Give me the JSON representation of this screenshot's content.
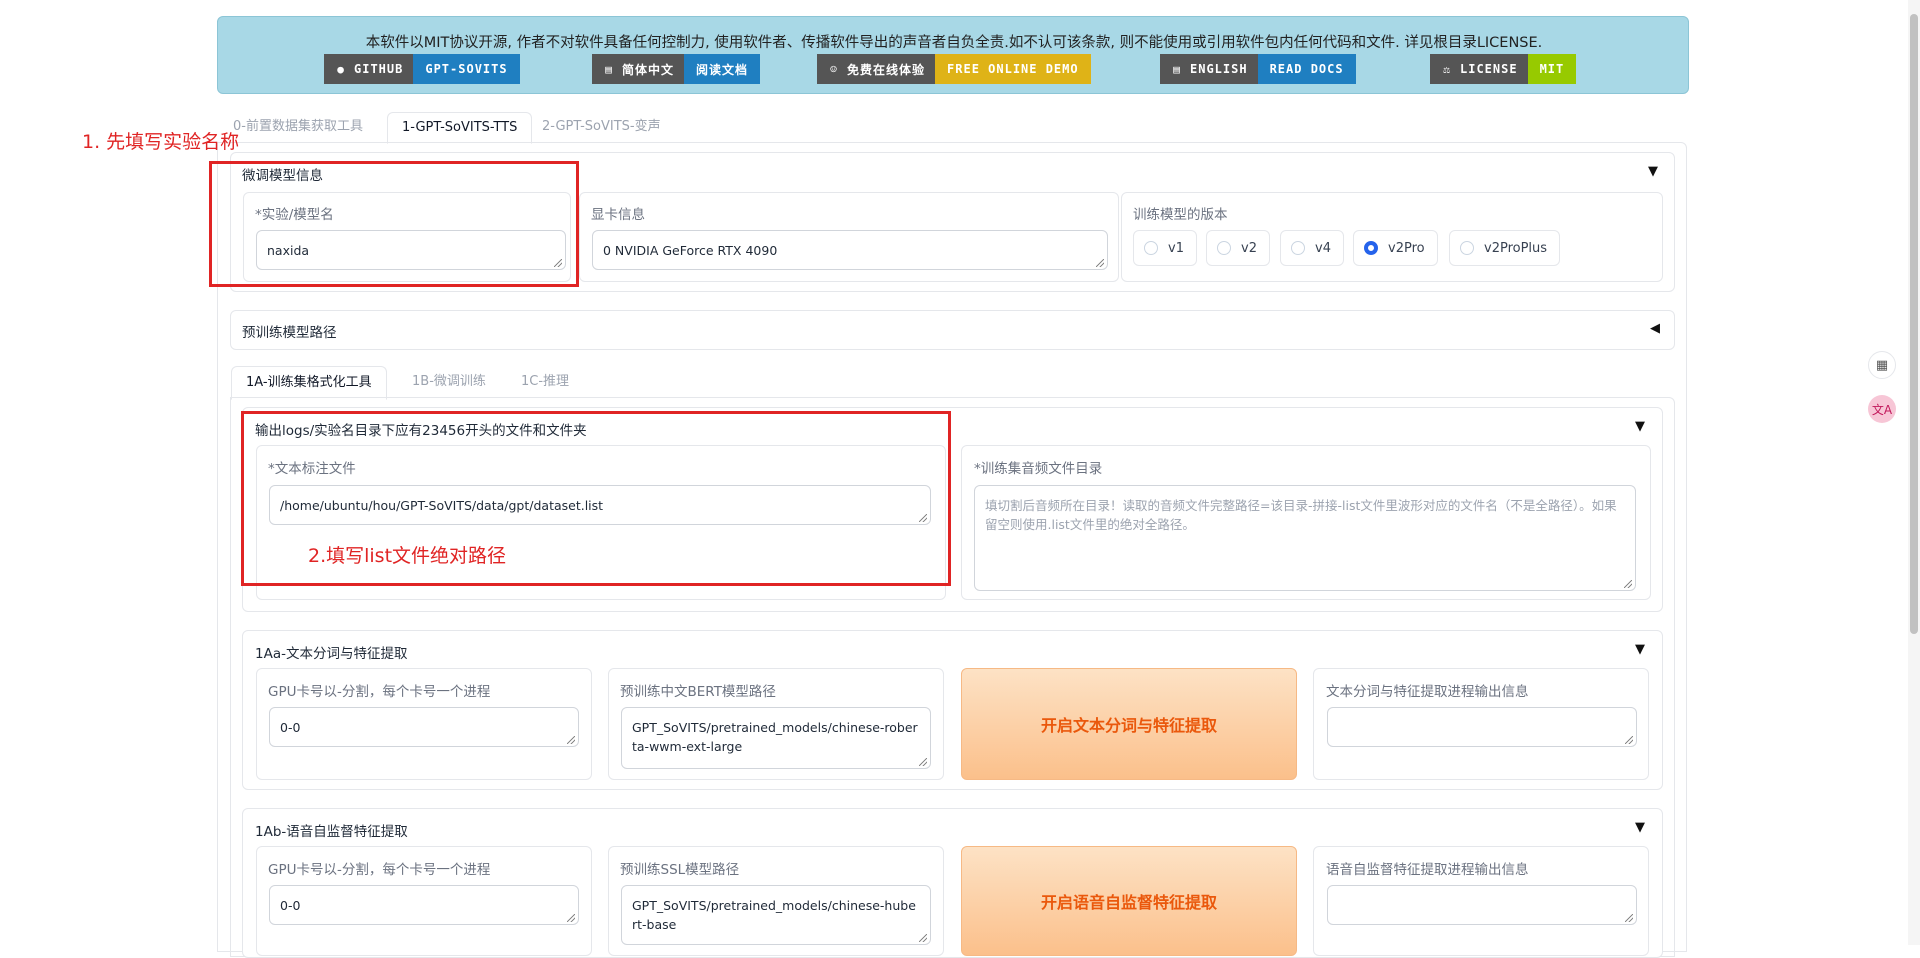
{
  "banner": {
    "notice": "本软件以MIT协议开源, 作者不对软件具备任何控制力, 使用软件者、传播软件导出的声音者自负全责.如不认可该条款, 则不能使用或引用软件包内任何代码和文件. 详见根目录LICENSE.",
    "badges": [
      {
        "left": "GITHUB",
        "right": "GPT-SOVITS",
        "icon": "github-icon",
        "color": "#1f7fc1"
      },
      {
        "left": "简体中文",
        "right": "阅读文档",
        "icon": "document-icon",
        "color": "#1f7fc1"
      },
      {
        "left": "免费在线体验",
        "right": "FREE ONLINE DEMO",
        "icon": "emoji-icon",
        "color": "#dfb317"
      },
      {
        "left": "ENGLISH",
        "right": "READ DOCS",
        "icon": "document-icon",
        "color": "#1f7fc1"
      },
      {
        "left": "LICENSE",
        "right": "MIT",
        "icon": "license-icon",
        "color": "#97ca00"
      }
    ]
  },
  "top_tabs": [
    "0-前置数据集获取工具",
    "1-GPT-SoVITS-TTS",
    "2-GPT-SoVITS-变声"
  ],
  "model_info": {
    "title": "微调模型信息",
    "exp_label": "*实验/模型名",
    "exp_value": "naxida",
    "gpu_label": "显卡信息",
    "gpu_value": "0 NVIDIA GeForce RTX 4090",
    "version_label": "训练模型的版本",
    "versions": [
      "v1",
      "v2",
      "v4",
      "v2Pro",
      "v2ProPlus"
    ],
    "selected_version": "v2Pro"
  },
  "pretrained": {
    "title": "预训练模型路径"
  },
  "sub_tabs": [
    "1A-训练集格式化工具",
    "1B-微调训练",
    "1C-推理"
  ],
  "format_tool": {
    "title": "输出logs/实验名目录下应有23456开头的文件和文件夹",
    "text_label": "*文本标注文件",
    "text_value": "/home/ubuntu/hou/GPT-SoVITS/data/gpt/dataset.list",
    "audio_label": "*训练集音频文件目录",
    "audio_placeholder": "填切割后音频所在目录！读取的音频文件完整路径=该目录-拼接-list文件里波形对应的文件名（不是全路径）。如果留空则使用.list文件里的绝对全路径。"
  },
  "section_1aa": {
    "title": "1Aa-文本分词与特征提取",
    "gpu_label": "GPU卡号以-分割，每个卡号一个进程",
    "gpu_value": "0-0",
    "bert_label": "预训练中文BERT模型路径",
    "bert_value": "GPT_SoVITS/pretrained_models/chinese-roberta-wwm-ext-large",
    "button": "开启文本分词与特征提取",
    "output_label": "文本分词与特征提取进程输出信息"
  },
  "section_1ab": {
    "title": "1Ab-语音自监督特征提取",
    "gpu_label": "GPU卡号以-分割，每个卡号一个进程",
    "gpu_value": "0-0",
    "ssl_label": "预训练SSL模型路径",
    "ssl_value": "GPT_SoVITS/pretrained_models/chinese-hubert-base",
    "button": "开启语音自监督特征提取",
    "output_label": "语音自监督特征提取进程输出信息"
  },
  "annotations": {
    "step1": "1. 先填写实验名称",
    "step2": "2.填写list文件绝对路径"
  }
}
